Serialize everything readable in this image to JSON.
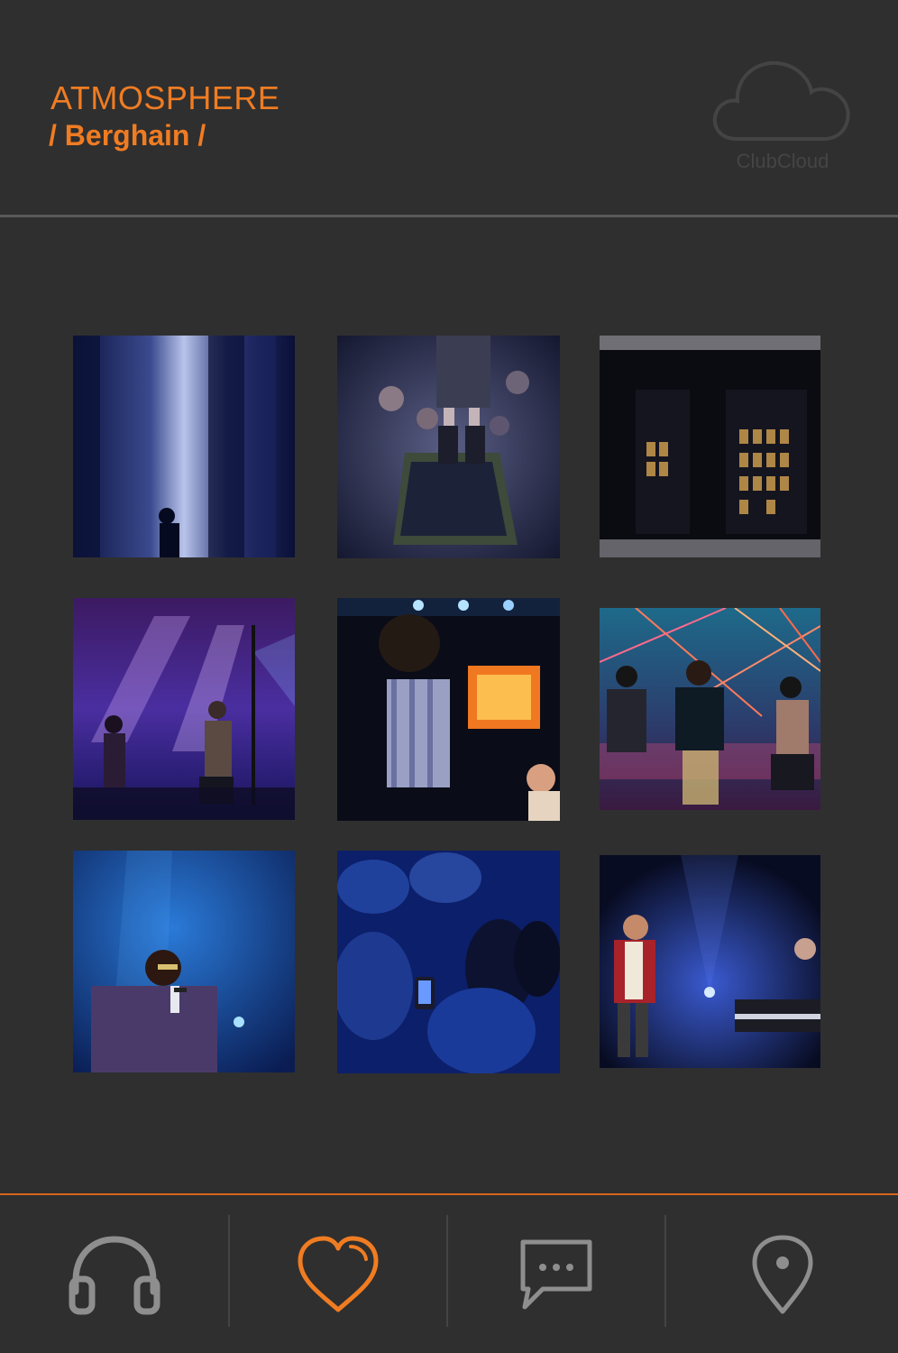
{
  "header": {
    "title": "ATMOSPHERE",
    "subtitle": "/ Berghain /",
    "logo_text": "ClubCloud"
  },
  "colors": {
    "accent": "#f07c22",
    "background": "#2f2f2f",
    "icon_inactive": "#8e8e8e"
  },
  "gallery": {
    "photos": [
      {
        "name": "photo-club-columns"
      },
      {
        "name": "photo-runway-boots"
      },
      {
        "name": "photo-building-night"
      },
      {
        "name": "photo-band-stage"
      },
      {
        "name": "photo-dancer-screen"
      },
      {
        "name": "photo-performers-lasers"
      },
      {
        "name": "photo-rapper-mic"
      },
      {
        "name": "photo-crowd-phones"
      },
      {
        "name": "photo-dancer-piano"
      }
    ]
  },
  "nav": {
    "items": [
      {
        "icon": "headphones-icon",
        "active": false
      },
      {
        "icon": "heart-icon",
        "active": true
      },
      {
        "icon": "chat-bubble-icon",
        "active": false
      },
      {
        "icon": "map-pin-icon",
        "active": false
      }
    ]
  }
}
